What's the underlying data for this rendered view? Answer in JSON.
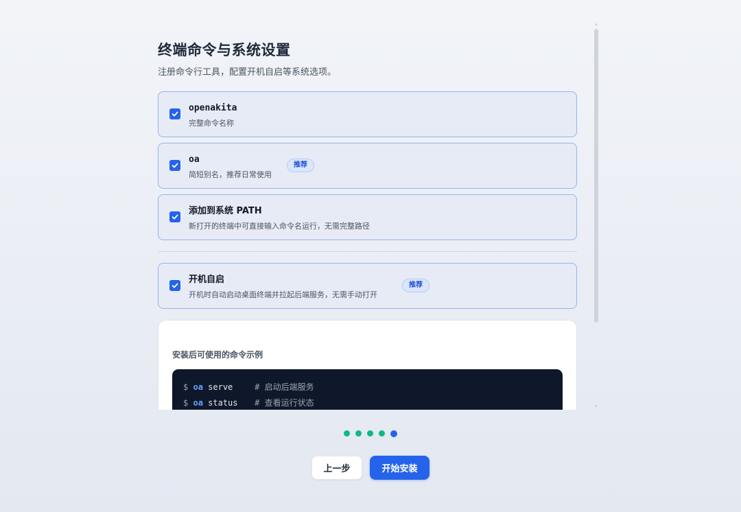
{
  "header": {
    "title": "终端命令与系统设置",
    "subtitle": "注册命令行工具，配置开机自启等系统选项。"
  },
  "options": [
    {
      "title": "openakita",
      "desc": "完整命令名称",
      "checked": true,
      "badge": ""
    },
    {
      "title": "oa",
      "desc": "简短别名，推荐日常使用",
      "checked": true,
      "badge": "推荐"
    },
    {
      "title": "添加到系统 PATH",
      "desc": "新打开的终端中可直接输入命令名运行，无需完整路径",
      "checked": true,
      "badge": ""
    },
    {
      "title": "开机自启",
      "desc": "开机时自动启动桌面终端并拉起后端服务，无需手动打开",
      "checked": true,
      "badge": "推荐"
    }
  ],
  "examples": {
    "title": "安装后可使用的命令示例",
    "lines": [
      {
        "prompt": "$",
        "cmd": "oa",
        "arg": "serve",
        "comment": "# 启动后端服务"
      },
      {
        "prompt": "$",
        "cmd": "oa",
        "arg": "status",
        "comment": "# 查看运行状态"
      }
    ]
  },
  "progress": {
    "total_steps": 5,
    "current_step": 5
  },
  "nav": {
    "prev_label": "上一步",
    "next_label": "开始安装"
  },
  "colors": {
    "accent": "#2563eb",
    "done_step": "#10b981",
    "code_bg": "#0f172a"
  }
}
